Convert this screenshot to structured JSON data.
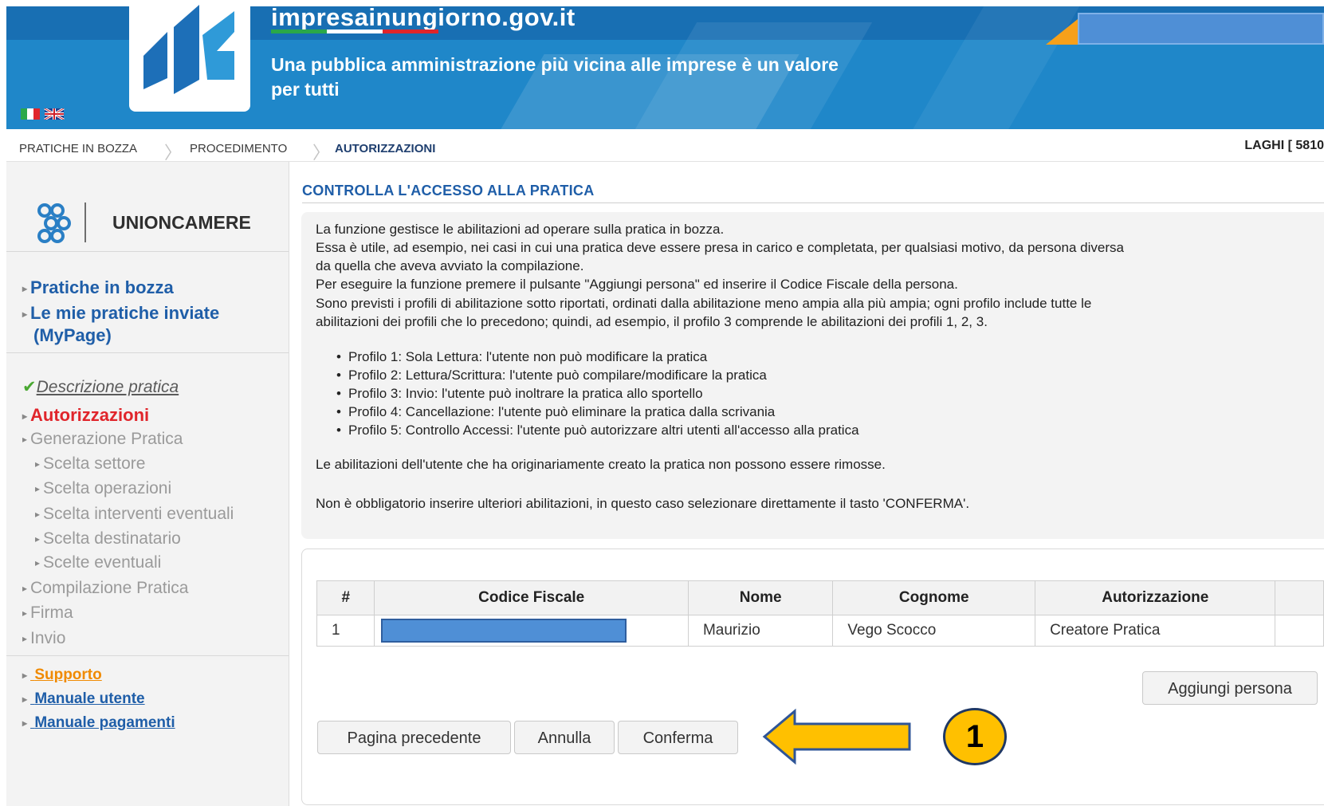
{
  "header": {
    "site_title": "impresainungiorno.gov.it",
    "tagline_line1": "Una pubblica amministrazione più vicina alle imprese è un valore",
    "tagline_line2": "per tutti",
    "colors": {
      "header_bg": "#1f87c9",
      "accent_orange": "#f6a01a"
    }
  },
  "breadcrumb": {
    "items": [
      "PRATICHE IN BOZZA",
      "PROCEDIMENTO",
      "AUTORIZZAZIONI"
    ],
    "user": "LAGHI [ 5810"
  },
  "sidebar": {
    "org": "UNIONCAMERE",
    "nav": [
      "Pratiche in bozza",
      "Le mie pratiche inviate",
      "(MyPage)"
    ],
    "steps": {
      "done": "Descrizione pratica",
      "current": "Autorizzazioni",
      "generazione": "Generazione Pratica",
      "sub": [
        "Scelta settore",
        "Scelta operazioni",
        "Scelta interventi eventuali",
        "Scelta destinatario",
        "Scelte eventuali"
      ],
      "rest": [
        "Compilazione Pratica",
        "Firma",
        "Invio"
      ]
    },
    "support": [
      "Supporto",
      "Manuale utente",
      "Manuale pagamenti"
    ]
  },
  "main": {
    "title": "CONTROLLA L'ACCESSO ALLA PRATICA",
    "paragraphs": [
      "La funzione gestisce le abilitazioni ad operare sulla pratica in bozza.",
      "Essa è utile, ad esempio, nei casi in cui una pratica deve essere presa in carico e completata, per qualsiasi motivo, da persona diversa",
      "da quella che aveva avviato la compilazione.",
      "Per eseguire la funzione premere il pulsante \"Aggiungi persona\" ed inserire il Codice Fiscale della persona.",
      "Sono previsti i profili di abilitazione sotto riportati, ordinati dalla abilitazione meno ampia alla più ampia; ogni profilo include tutte le",
      "abilitazioni dei profili che lo precedono; quindi, ad esempio, il profilo 3 comprende le abilitazioni dei profili 1, 2, 3."
    ],
    "profiles": [
      "Profilo 1: Sola Lettura: l'utente non può modificare la pratica",
      "Profilo 2: Lettura/Scrittura: l'utente può compilare/modificare la pratica",
      "Profilo 3: Invio: l'utente può inoltrare la pratica allo sportello",
      "Profilo 4: Cancellazione: l'utente può eliminare la pratica dalla scrivania",
      "Profilo 5: Controllo Accessi: l'utente può autorizzare altri utenti all'accesso alla pratica"
    ],
    "note1": "Le abilitazioni dell'utente che ha originariamente creato la pratica non possono essere rimosse.",
    "note2": "Non è obbligatorio inserire ulteriori abilitazioni, in questo caso selezionare direttamente il tasto 'CONFERMA'."
  },
  "table": {
    "headers": [
      "#",
      "Codice Fiscale",
      "Nome",
      "Cognome",
      "Autorizzazione"
    ],
    "rows": [
      {
        "num": "1",
        "nome": "Maurizio",
        "cognome": "Vego Scocco",
        "autorizzazione": "Creatore Pratica"
      }
    ]
  },
  "buttons": {
    "add_person": "Aggiungi persona",
    "prev": "Pagina precedente",
    "cancel": "Annulla",
    "confirm": "Conferma"
  },
  "annotation": {
    "callout_number": "1",
    "arrow_color": "#ffc000"
  }
}
